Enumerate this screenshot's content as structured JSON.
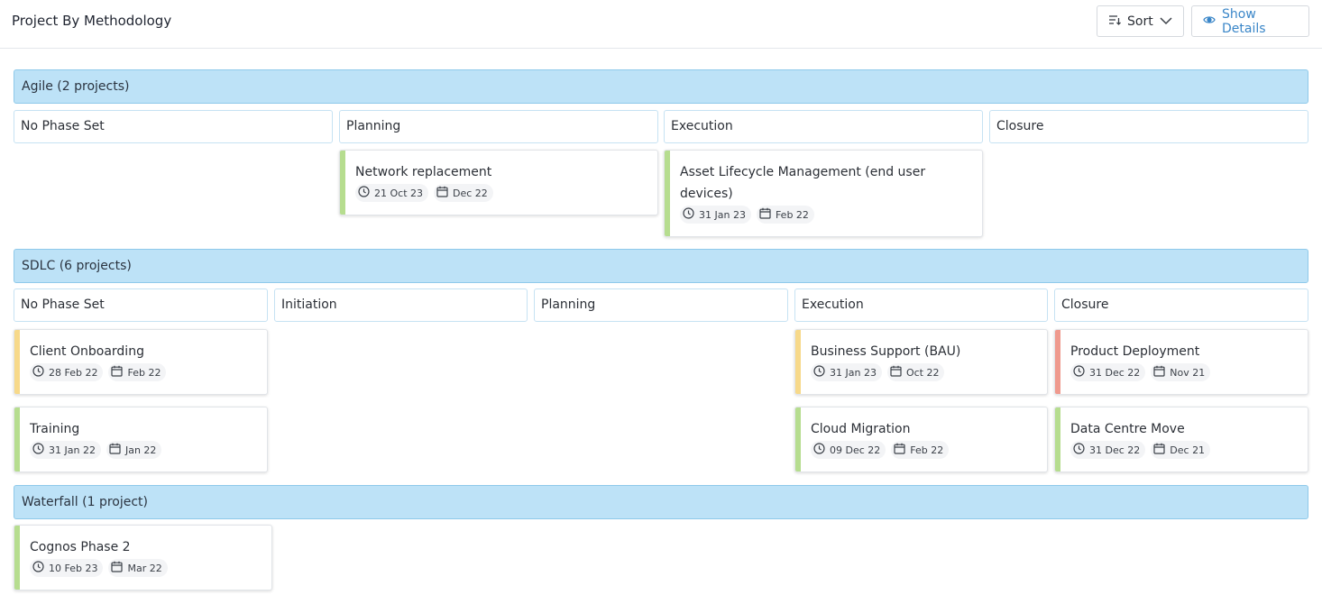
{
  "header": {
    "title": "Project By Methodology",
    "sort_label": "Sort",
    "details_label": "Show Details"
  },
  "colors": {
    "green": "#b6dd8f",
    "yellow": "#f7d98a",
    "red": "#ef9a8e",
    "groupHeader": "#bde2f7"
  },
  "groups": [
    {
      "label": "Agile (2 projects)",
      "phases": [
        "No Phase Set",
        "Planning",
        "Execution",
        "Closure"
      ],
      "cards": [
        {
          "title": "Network replacement",
          "date": "21 Oct 23",
          "period": "Dec 22",
          "status": "green"
        },
        {
          "title": "Asset Lifecycle Management (end user devices)",
          "date": "31 Jan 23",
          "period": "Feb 22",
          "status": "green"
        }
      ]
    },
    {
      "label": "SDLC (6 projects)",
      "phases": [
        "No Phase Set",
        "Initiation",
        "Planning",
        "Execution",
        "Closure"
      ],
      "cards": [
        {
          "title": "Client Onboarding",
          "date": "28 Feb 22",
          "period": "Feb 22",
          "status": "yellow"
        },
        {
          "title": "Training",
          "date": "31 Jan 22",
          "period": "Jan 22",
          "status": "green"
        },
        {
          "title": "Business Support (BAU)",
          "date": "31 Jan 23",
          "period": "Oct 22",
          "status": "yellow"
        },
        {
          "title": "Cloud Migration",
          "date": "09 Dec 22",
          "period": "Feb 22",
          "status": "green"
        },
        {
          "title": "Product Deployment",
          "date": "31 Dec 22",
          "period": "Nov 21",
          "status": "red"
        },
        {
          "title": "Data Centre Move",
          "date": "31 Dec 22",
          "period": "Dec 21",
          "status": "green"
        }
      ]
    },
    {
      "label": "Waterfall (1 project)",
      "cards": [
        {
          "title": "Cognos Phase 2",
          "date": "10 Feb 23",
          "period": "Mar 22",
          "status": "green"
        }
      ]
    }
  ]
}
